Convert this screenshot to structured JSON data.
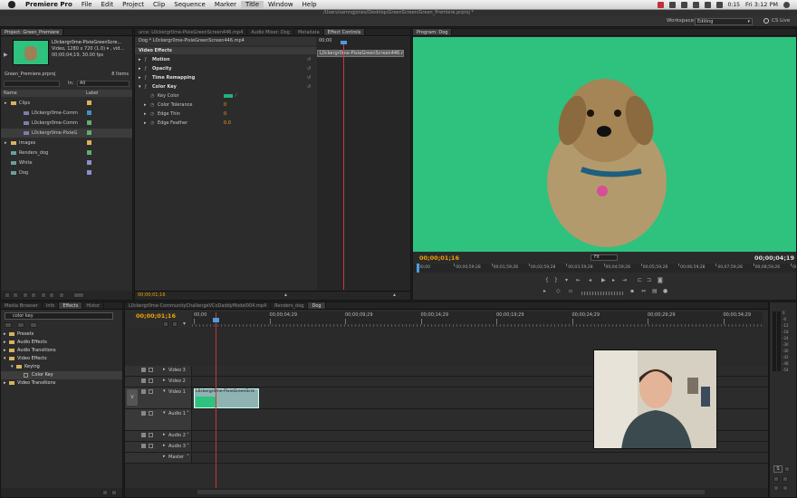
{
  "menubar": {
    "app": "Premiere Pro",
    "items": [
      "File",
      "Edit",
      "Project",
      "Clip",
      "Sequence",
      "Marker",
      "Title",
      "Window",
      "Help"
    ],
    "active": "Title",
    "clock": "Fri 3:12 PM",
    "battery": "0:15"
  },
  "window_title": "/Users/samngjones/Desktop/GreenScreen/Green_Premiere.prproj *",
  "workspace": {
    "label": "Workspace:",
    "value": "Editing",
    "cs_live": "CS Live"
  },
  "project": {
    "tab": "Project: Green_Premiere",
    "clip_name": "L0ckergr0me-PixieGreenScre...",
    "clip_info_1": "Video, 1280 x 720 (1.0) ▾ , vid...",
    "clip_info_2": "00;00;04;19, 30.00 fps",
    "file": "Green_Premiere.prproj",
    "items_count": "8 Items",
    "in_label": "In:",
    "in_value": "All",
    "col_name": "Name",
    "col_label": "Label",
    "rows": [
      {
        "name": "Clips",
        "type": "folder",
        "indent": 0,
        "color": "#d7b35b"
      },
      {
        "name": "L0ckergr0me-Comm",
        "type": "clip",
        "indent": 1,
        "color": "#3e8fc4"
      },
      {
        "name": "L0ckergr0me-Comm",
        "type": "clip",
        "indent": 1,
        "color": "#5fae6e"
      },
      {
        "name": "L0ckergr0me-PixieG",
        "type": "clip",
        "indent": 1,
        "color": "#5fae6e"
      },
      {
        "name": "Images",
        "type": "folder",
        "indent": 0,
        "color": "#d7b35b"
      },
      {
        "name": "Renders_dog",
        "type": "seq",
        "indent": 0,
        "color": "#5fae6e"
      },
      {
        "name": "White",
        "type": "seq",
        "indent": 0,
        "color": "#8e8ecf"
      },
      {
        "name": "Dog",
        "type": "seq",
        "indent": 0,
        "color": "#8e8ecf"
      }
    ]
  },
  "effect_controls": {
    "tabs": [
      "urce: L0ckergr0me-PixieGreenScreen446.mp4",
      "Audio Mixer: Dog",
      "Metadata",
      "Effect Controls"
    ],
    "active_tab": 3,
    "clip_path": "Dog * L0ckergr0me-PixieGreenScreen446.mp4",
    "clip_chip": "L0ckergr0me-PixieGreenScreen446.mp4",
    "ruler_start": "00;00",
    "section": "Video Effects",
    "effects": [
      {
        "name": "Motion",
        "bold": true,
        "expanded": false
      },
      {
        "name": "Opacity",
        "bold": true,
        "expanded": false
      },
      {
        "name": "Time Remapping",
        "bold": true,
        "expanded": false
      },
      {
        "name": "Color Key",
        "bold": true,
        "expanded": true
      }
    ],
    "params": [
      {
        "name": "Key Color",
        "value": ""
      },
      {
        "name": "Color Tolerance",
        "value": "0"
      },
      {
        "name": "Edge Thin",
        "value": "0"
      },
      {
        "name": "Edge Feather",
        "value": "0.0"
      }
    ],
    "key_color": "#1fb477",
    "timecode": "00;00;01;16"
  },
  "program": {
    "tab": "Program: Dog",
    "timecode_left": "00;00;01;16",
    "fit": "Fit",
    "timecode_right": "00;00;04;19",
    "ruler": [
      "00;00",
      "00;00;59;28",
      "00;01;59;28",
      "00;02;59;28",
      "00;03;59;28",
      "00;04;59;28",
      "00;05;59;28",
      "00;06;59;28",
      "00;07;59;28",
      "00;08;59;26",
      "00;10;0"
    ],
    "screen_color": "#2ec27e"
  },
  "effects_panel": {
    "tabs": [
      "Media Browser",
      "Info",
      "Effects",
      "Histor"
    ],
    "active_tab": 2,
    "search": "color key",
    "tree": [
      {
        "name": "Presets",
        "indent": 0,
        "icon": "folder"
      },
      {
        "name": "Audio Effects",
        "indent": 0,
        "icon": "folder"
      },
      {
        "name": "Audio Transitions",
        "indent": 0,
        "icon": "folder"
      },
      {
        "name": "Video Effects",
        "indent": 0,
        "icon": "folder"
      },
      {
        "name": "Keying",
        "indent": 1,
        "icon": "folder"
      },
      {
        "name": "Color Key",
        "indent": 2,
        "icon": "effect"
      },
      {
        "name": "Video Transitions",
        "indent": 0,
        "icon": "folder"
      }
    ]
  },
  "timeline": {
    "tabs": [
      "L0ckergr0me-CommunityChallengeVCoDaddyModel004.mp4",
      "Renders_dog",
      "Dog"
    ],
    "active_tab": 2,
    "timecode": "00;00;01;16",
    "ruler": [
      "00;00",
      "00;00;04;29",
      "00;00;09;29",
      "00;00;14;29",
      "00;00;19;29",
      "00;00;24;29",
      "00;00;29;29",
      "00;00;34;29"
    ],
    "tracks": [
      {
        "name": "Video 3",
        "kind": "video"
      },
      {
        "name": "Video 2",
        "kind": "video"
      },
      {
        "name": "Video 1",
        "kind": "video",
        "active": true
      },
      {
        "name": "Audio 1",
        "kind": "audio",
        "active": true
      },
      {
        "name": "Audio 2",
        "kind": "audio"
      },
      {
        "name": "Audio 3",
        "kind": "audio"
      },
      {
        "name": "Master",
        "kind": "master"
      }
    ],
    "v_label": "V",
    "clip_label": "L0ckergr0me-PixieGreenScre"
  },
  "audio_meter": {
    "scale": [
      "0",
      "-6",
      "-12",
      "-18",
      "-24",
      "-30",
      "-36",
      "-42",
      "-48",
      "-54"
    ],
    "solo": "S"
  }
}
